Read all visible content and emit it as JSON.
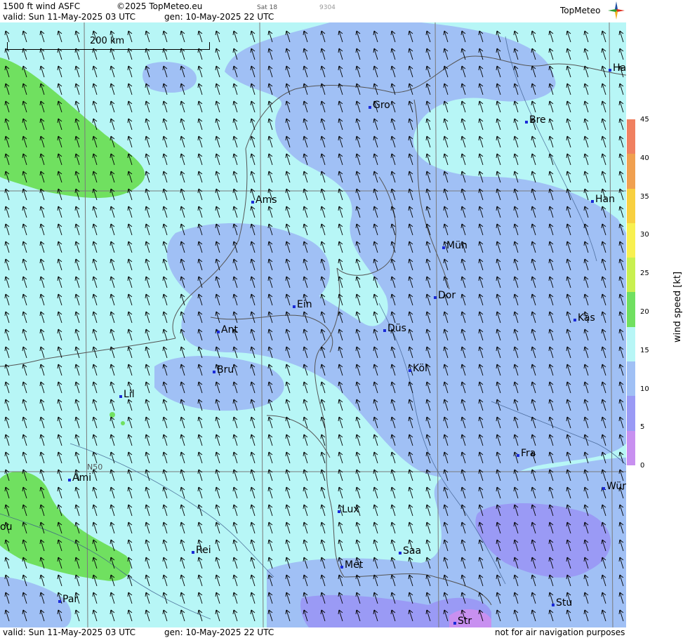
{
  "header": {
    "product": "1500 ft wind ASFC",
    "copyright": "©2025 TopMeteo.eu",
    "sat_label": "Sat 18",
    "code_label": "9304",
    "valid": "valid:  Sun  11-May-2025  03 UTC",
    "gen": "gen: 10-May-2025 22 UTC",
    "logo": "TopMeteo"
  },
  "map": {
    "scale_label": "200 km",
    "lat_label": "N50",
    "cities": [
      {
        "label": "Ha"
      },
      {
        "label": "Gro"
      },
      {
        "label": "Bre"
      },
      {
        "label": "Ams"
      },
      {
        "label": "Han"
      },
      {
        "label": "Mün"
      },
      {
        "label": "Dor"
      },
      {
        "label": "Ein"
      },
      {
        "label": "Kas"
      },
      {
        "label": "Düs"
      },
      {
        "label": "Ant"
      },
      {
        "label": "Köl"
      },
      {
        "label": "Bru"
      },
      {
        "label": "Lil"
      },
      {
        "label": "Fra"
      },
      {
        "label": "Ami"
      },
      {
        "label": "Wür"
      },
      {
        "label": "ou"
      },
      {
        "label": "Lux"
      },
      {
        "label": "Rei"
      },
      {
        "label": "Saa"
      },
      {
        "label": "Met"
      },
      {
        "label": "Par"
      },
      {
        "label": "Stu"
      },
      {
        "label": "Str"
      }
    ],
    "wind_direction": "from SSE (arrows pointing NNW)",
    "colors": {
      "calm": "#c890f0",
      "5_10": "#9a9af5",
      "10_15": "#a0c0f5",
      "15_20": "#b7f6f6",
      "20_25": "#70e060"
    }
  },
  "legend": {
    "title": "wind  speed  [kt]",
    "ticks": [
      "45",
      "40",
      "35",
      "30",
      "25",
      "20",
      "15",
      "10",
      "5",
      "0"
    ],
    "colors": [
      "#f08060",
      "#f0a050",
      "#f8d040",
      "#f8f050",
      "#c8f050",
      "#70e060",
      "#b7f6f6",
      "#a0c0f5",
      "#9a9af5",
      "#c890f0"
    ]
  },
  "footer": {
    "valid": "valid:  Sun  11-May-2025  03 UTC",
    "gen": "gen: 10-May-2025 22 UTC",
    "disclaimer": "not for air navigation purposes"
  }
}
